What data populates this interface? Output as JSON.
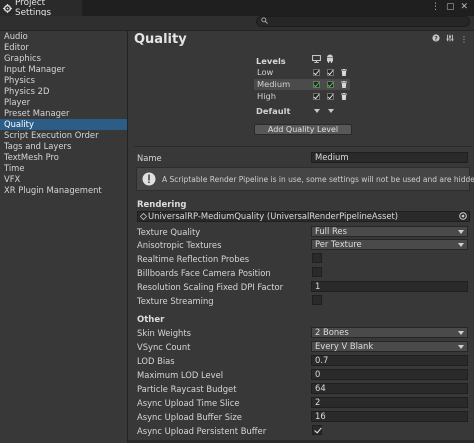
{
  "window": {
    "title": "Project Settings",
    "menu_icon": "kebab-menu-icon",
    "maximize_icon": "maximize-icon",
    "close_icon": "close-icon"
  },
  "search": {
    "placeholder": "",
    "value": ""
  },
  "sidebar": {
    "items": [
      {
        "label": "Audio"
      },
      {
        "label": "Editor"
      },
      {
        "label": "Graphics"
      },
      {
        "label": "Input Manager"
      },
      {
        "label": "Physics"
      },
      {
        "label": "Physics 2D"
      },
      {
        "label": "Player"
      },
      {
        "label": "Preset Manager"
      },
      {
        "label": "Quality",
        "selected": true
      },
      {
        "label": "Script Execution Order"
      },
      {
        "label": "Tags and Layers"
      },
      {
        "label": "TextMesh Pro"
      },
      {
        "label": "Time"
      },
      {
        "label": "VFX"
      },
      {
        "label": "XR Plugin Management"
      }
    ]
  },
  "main": {
    "title": "Quality",
    "header_icons": [
      "help-icon",
      "preset-icon",
      "settings-icon"
    ],
    "levels": {
      "heading": "Levels",
      "column_icons": [
        "standalone-monitor-icon",
        "android-icon"
      ],
      "rows": [
        {
          "name": "Low",
          "standalone": true,
          "android": true,
          "android_green": false,
          "selected": false
        },
        {
          "name": "Medium",
          "standalone": true,
          "android": true,
          "android_green": true,
          "selected": true
        },
        {
          "name": "High",
          "standalone": true,
          "android": true,
          "android_green": false,
          "selected": false
        }
      ],
      "default_label": "Default",
      "add_button": "Add Quality Level"
    },
    "name": {
      "label": "Name",
      "value": "Medium"
    },
    "help_box": {
      "text": "A Scriptable Render Pipeline is in use, some settings will not be used and are hidden"
    },
    "rendering": {
      "heading": "Rendering",
      "asset": "UniversalRP-MediumQuality (UniversalRenderPipelineAsset)",
      "texture_quality": {
        "label": "Texture Quality",
        "value": "Full Res"
      },
      "anisotropic": {
        "label": "Anisotropic Textures",
        "value": "Per Texture"
      },
      "realtime_probes": {
        "label": "Realtime Reflection Probes",
        "checked": false
      },
      "billboards": {
        "label": "Billboards Face Camera Position",
        "checked": false
      },
      "res_scaling": {
        "label": "Resolution Scaling Fixed DPI Factor",
        "value": "1"
      },
      "texture_streaming": {
        "label": "Texture Streaming",
        "checked": false
      }
    },
    "other": {
      "heading": "Other",
      "skin_weights": {
        "label": "Skin Weights",
        "value": "2 Bones"
      },
      "vsync": {
        "label": "VSync Count",
        "value": "Every V Blank"
      },
      "lod_bias": {
        "label": "LOD Bias",
        "value": "0.7"
      },
      "max_lod": {
        "label": "Maximum LOD Level",
        "value": "0"
      },
      "particle_budget": {
        "label": "Particle Raycast Budget",
        "value": "64"
      },
      "async_time": {
        "label": "Async Upload Time Slice",
        "value": "2"
      },
      "async_buffer": {
        "label": "Async Upload Buffer Size",
        "value": "16"
      },
      "async_persistent": {
        "label": "Async Upload Persistent Buffer",
        "checked": true
      }
    }
  },
  "colors": {
    "background": "#383838",
    "selection": "#2c5d87",
    "field": "#2a2a2a",
    "green_check": "#39d139"
  }
}
